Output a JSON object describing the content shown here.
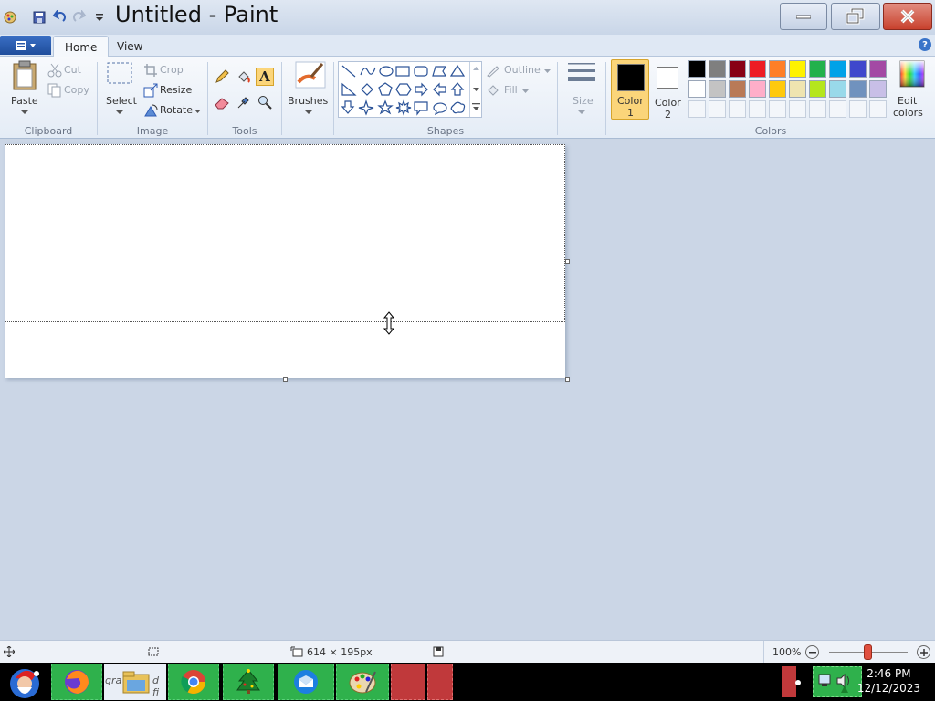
{
  "window": {
    "title": "Untitled - Paint"
  },
  "tabs": {
    "home": "Home",
    "view": "View"
  },
  "clipboard": {
    "paste": "Paste",
    "cut": "Cut",
    "copy": "Copy",
    "group": "Clipboard"
  },
  "image": {
    "select": "Select",
    "crop": "Crop",
    "resize": "Resize",
    "rotate": "Rotate",
    "group": "Image"
  },
  "tools": {
    "group": "Tools",
    "text_glyph": "A"
  },
  "brushes": {
    "label": "Brushes"
  },
  "shapes": {
    "outline": "Outline",
    "fill": "Fill",
    "group": "Shapes"
  },
  "size": {
    "label": "Size"
  },
  "colors": {
    "color1": "Color",
    "color1_num": "1",
    "color2": "Color",
    "color2_num": "2",
    "edit": "Edit",
    "edit2": "colors",
    "group": "Colors",
    "palette_row1": [
      "#000000",
      "#7f7f7f",
      "#880015",
      "#ed1c24",
      "#ff7f27",
      "#fff200",
      "#22b14c",
      "#00a2e8",
      "#3f48cc",
      "#a349a4"
    ],
    "palette_row2": [
      "#ffffff",
      "#c3c3c3",
      "#b97a57",
      "#ffaec9",
      "#ffc90e",
      "#efe4b0",
      "#b5e61d",
      "#99d9ea",
      "#7092be",
      "#c8bfe7"
    ]
  },
  "status": {
    "dimensions": "614 × 195px",
    "zoom": "100%"
  },
  "taskbar": {
    "explorer_label": "gra",
    "explorer_label2": "d fi",
    "time": "2:46 PM",
    "date": "12/12/2023"
  }
}
